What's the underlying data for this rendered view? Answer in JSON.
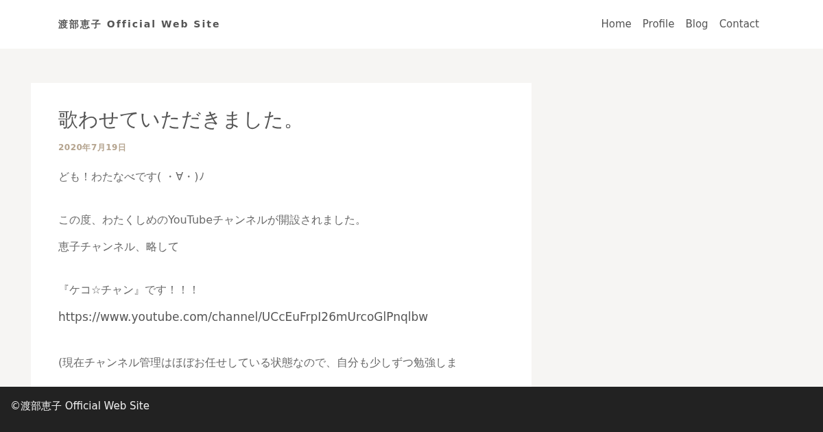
{
  "header": {
    "site_title": "渡部恵子 Official Web Site",
    "nav": [
      {
        "label": "Home"
      },
      {
        "label": "Profile"
      },
      {
        "label": "Blog"
      },
      {
        "label": "Contact"
      }
    ]
  },
  "post": {
    "title": "歌わせていただきました。",
    "date": "2020年7月19日",
    "paragraphs": [
      {
        "kind": "text",
        "text": "ども！わたなべです( ・∀・)ﾉ"
      },
      {
        "kind": "gap"
      },
      {
        "kind": "text",
        "text": "この度、わたくしめのYouTubeチャンネルが開設されました。"
      },
      {
        "kind": "text",
        "text": "恵子チャンネル、略して"
      },
      {
        "kind": "gap"
      },
      {
        "kind": "text",
        "text": "『ケコ☆チャン』です！！！"
      },
      {
        "kind": "link",
        "text": "https://www.youtube.com/channel/UCcEuFrpI26mUrcoGlPnqlbw"
      },
      {
        "kind": "gap"
      },
      {
        "kind": "text",
        "text": "(現在チャンネル管理はほぼお任せしている状態なので、自分も少しずつ勉強しま"
      }
    ]
  },
  "footer": {
    "copyright": "©渡部恵子 Official Web Site"
  }
}
